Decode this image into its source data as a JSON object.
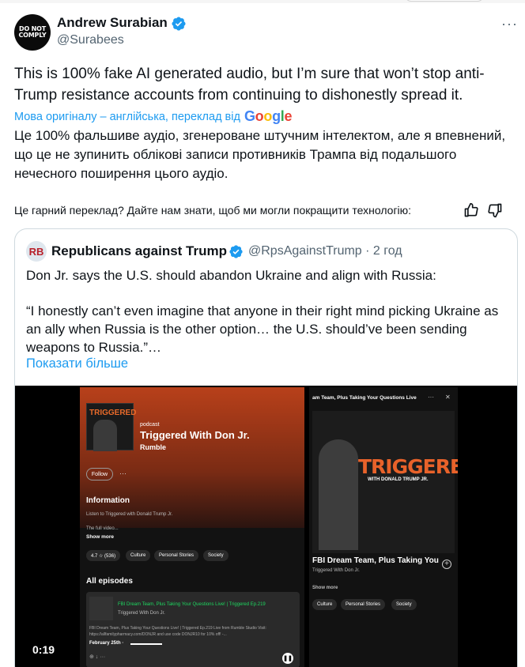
{
  "author": {
    "avatar_text": "DO NOT COMPLY",
    "name": "Andrew Surabian",
    "handle": "@Surabees",
    "more_icon": "···"
  },
  "tweet": {
    "text": "This is 100% fake AI generated audio, but I’m sure that won’t stop anti-Trump resistance accounts from continuing to dishonestly spread it.",
    "translation_note": "Мова оригіналу – англійська, переклад від",
    "translated_text": "Це 100% фальшиве аудіо, згенероване штучним інтелектом, але я впевнений, що це не зупинить облікові записи противників Трампа від подальшого нечесного поширення цього аудіо.",
    "rate_prompt": "Це гарний переклад? Дайте нам знати, щоб ми могли покращити технологію:"
  },
  "google": {
    "letters": [
      "G",
      "o",
      "o",
      "g",
      "l",
      "e"
    ],
    "colors": [
      "#4285f4",
      "#ea4335",
      "#fbbc05",
      "#4285f4",
      "#34a853",
      "#ea4335"
    ]
  },
  "quote": {
    "avatar_text": "RB",
    "name": "Republicans against Trump",
    "handle": "@RpsAgainstTrump · 2 год",
    "text": "Don Jr. says the U.S. should abandon Ukraine and align with Russia:",
    "quote_text": "“I honestly can’t even imagine that anyone in their right mind picking Ukraine as an ally when Russia is the other option… the U.S. should’ve been sending weapons to Russia.”…",
    "show_more": "Показати більше"
  },
  "video": {
    "timestamp": "0:19",
    "left_panel": {
      "cover_title": "TRIGGERED",
      "podcast_label": "podcast",
      "show_title": "Triggered With Don Jr.",
      "publisher": "Rumble",
      "follow": "Follow",
      "dots": "···",
      "info_heading": "Information",
      "info_text": "Listen to Triggered with Donald Trump Jr.",
      "info_video": "The full video...",
      "show_more": "Show more",
      "chips": [
        "4.7 ☆ (536)",
        "Culture",
        "Personal Stories",
        "Society"
      ],
      "episodes_heading": "All episodes",
      "episode_title": "FBI Dream Team, Plus Taking Your Questions Live! | Triggered Ep.219",
      "episode_sub": "Triggered With Don Jr.",
      "episode_desc": "FBI Dream Team, Plus Taking Your Questions Live! | Triggered Ep.219 Live from Rumble Studio Visit: https://allfamilypharmacy.com/DONJR and use code DONJR10 for 10% off! -...",
      "episode_date": "February 25th ·",
      "episode_icons": "⊕   ↓   ···",
      "pause_icon": "❚❚"
    },
    "right_panel": {
      "top_title": "am Team, Plus Taking Your Questions Live",
      "dots": "···",
      "close": "✕",
      "cover_big": "TRIGGERED",
      "cover_with": "WITH DONALD TRUMP JR.",
      "episode_title": "FBI Dream Team, Plus Taking You",
      "add_icon": "+",
      "episode_sub": "Triggered With Don Jr.",
      "show_more": "Show more",
      "chips": [
        "Culture",
        "Personal Stories",
        "Society"
      ]
    }
  },
  "colors": {
    "verified_blue": "#1d9bf0",
    "link_blue": "#1d9bf0",
    "text_secondary": "#536471",
    "triggered_orange": "#e8622a",
    "spotify_green": "#1ed760"
  }
}
